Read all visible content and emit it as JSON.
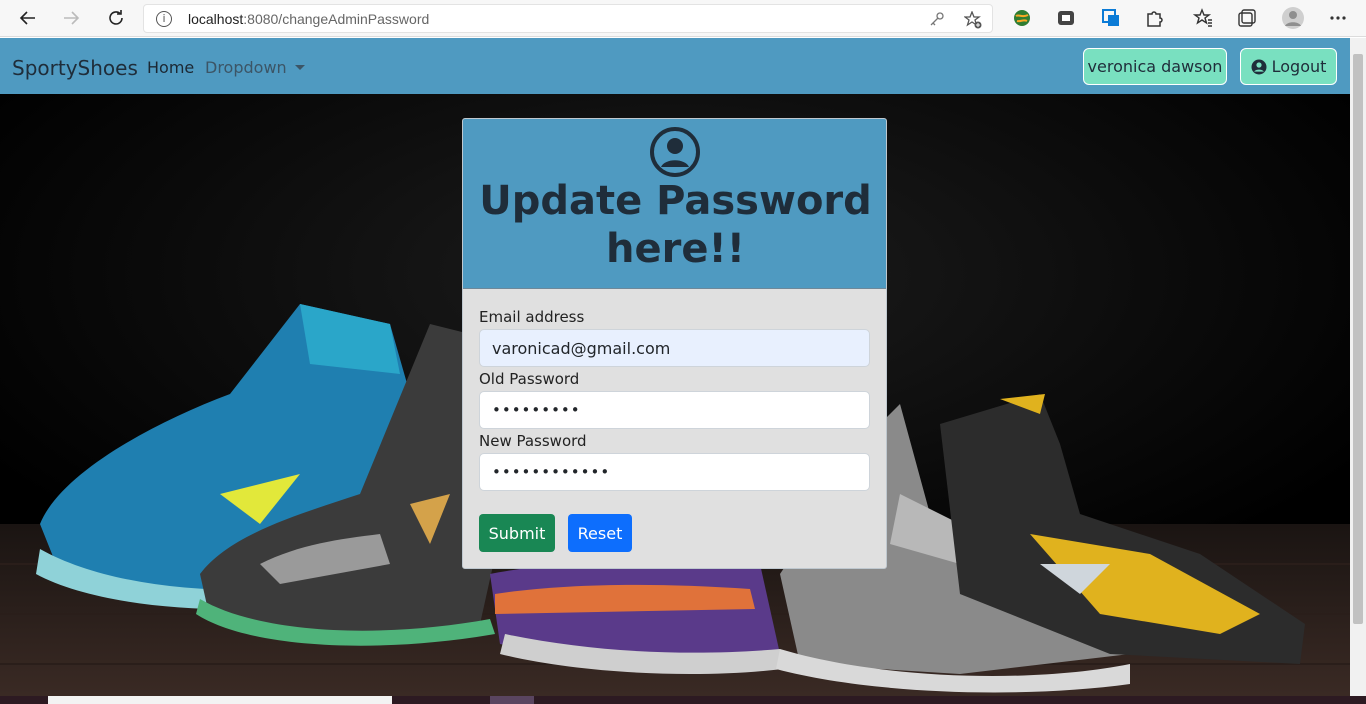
{
  "browser": {
    "url_host": "localhost",
    "url_path": ":8080/changeAdminPassword"
  },
  "navbar": {
    "brand": "SportyShoes",
    "home": "Home",
    "dropdown": "Dropdown",
    "user": "veronica dawson",
    "logout": "Logout"
  },
  "form": {
    "title": "Update Password here!!",
    "email_label": "Email address",
    "email_value": "varonicad@gmail.com",
    "old_password_label": "Old Password",
    "old_password_value": "•••••••••",
    "new_password_label": "New Password",
    "new_password_value": "••••••••••••",
    "submit_label": "Submit",
    "reset_label": "Reset"
  },
  "colors": {
    "navbar": "#4f9ac1",
    "user_buttons": "#79e0c0",
    "submit": "#198754",
    "reset": "#0d6efd"
  },
  "icons": [
    "back-icon",
    "forward-icon",
    "reload-icon",
    "info-icon",
    "key-icon",
    "favorite-add-icon",
    "extension-icon",
    "favorites-icon",
    "collections-icon",
    "profile-icon",
    "more-icon",
    "user-circle-icon"
  ]
}
